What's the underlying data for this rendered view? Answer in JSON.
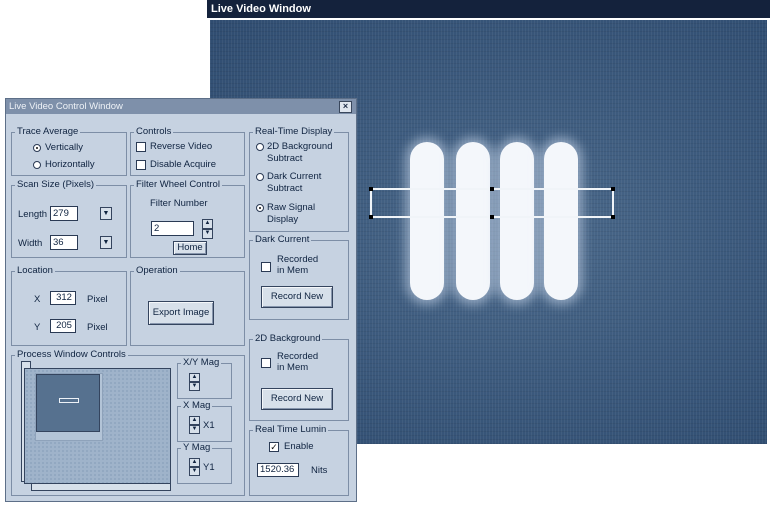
{
  "video_window": {
    "title": "Live Video Window"
  },
  "control_window": {
    "title": "Live Video Control Window",
    "close_label": "×",
    "trace_average": {
      "title": "Trace Average",
      "vertically": "Vertically",
      "horizontally": "Horizontally",
      "selected": "Vertically"
    },
    "controls": {
      "title": "Controls",
      "reverse_video": "Reverse Video",
      "disable_acquire": "Disable Acquire"
    },
    "realtime_display": {
      "title": "Real-Time Display",
      "opt_2d": "2D Background Subtract",
      "opt_dark": "Dark Current Subtract",
      "opt_raw": "Raw Signal Display",
      "selected": "Raw Signal Display"
    },
    "scan_size": {
      "title": "Scan Size (Pixels)",
      "length_label": "Length",
      "length_value": "279",
      "width_label": "Width",
      "width_value": "36"
    },
    "filter_wheel": {
      "title": "Filter Wheel Control",
      "filter_number_label": "Filter Number",
      "filter_number_value": "2",
      "home_label": "Home"
    },
    "dark_current": {
      "title": "Dark Current",
      "recorded_label": "Recorded in Mem",
      "record_new_label": "Record New"
    },
    "location": {
      "title": "Location",
      "x_label": "X",
      "x_value": "312",
      "y_label": "Y",
      "y_value": "205",
      "unit": "Pixel"
    },
    "operation": {
      "title": "Operation",
      "export_label": "Export Image"
    },
    "background_2d": {
      "title": "2D Background",
      "recorded_label": "Recorded in Mem",
      "record_new_label": "Record New"
    },
    "process_window": {
      "title": "Process Window Controls",
      "xy_mag_label": "X/Y Mag",
      "x_mag_label": "X Mag",
      "x_mag_value": "X1",
      "y_mag_label": "Y Mag",
      "y_mag_value": "Y1"
    },
    "realtime_lumin": {
      "title": "Real Time Lumin",
      "enable_label": "Enable",
      "value": "1520.36",
      "unit": "Nits"
    }
  }
}
